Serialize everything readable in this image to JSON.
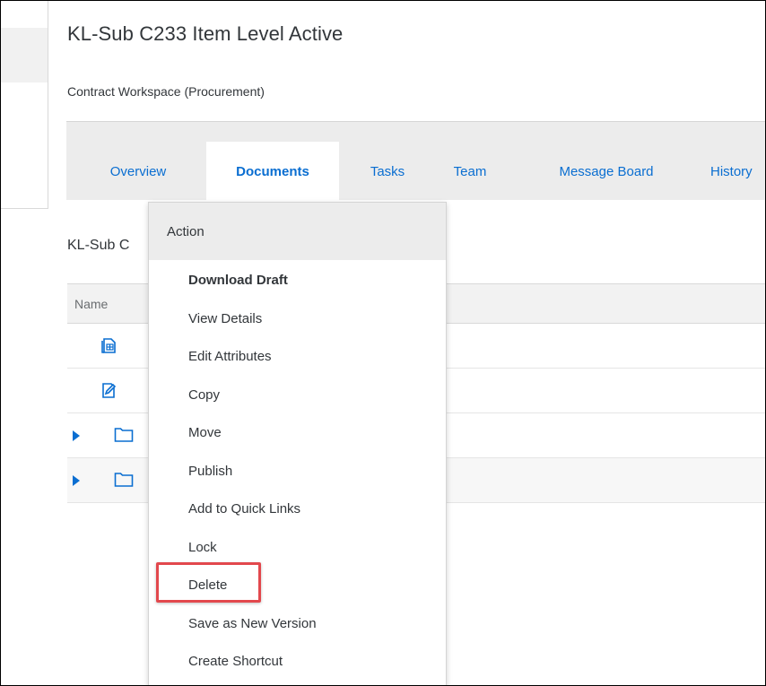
{
  "header": {
    "title": "KL-Sub C233 Item Level Active",
    "subtitle": "Contract Workspace (Procurement)"
  },
  "tabs": [
    {
      "label": "Overview",
      "active": false
    },
    {
      "label": "Documents",
      "active": true
    },
    {
      "label": "Tasks",
      "active": false
    },
    {
      "label": "Team",
      "active": false
    },
    {
      "label": "Message Board",
      "active": false
    },
    {
      "label": "History",
      "active": false
    }
  ],
  "content": {
    "crumb": "KL-Sub C",
    "table": {
      "columns": [
        "Name"
      ],
      "rows": [
        {
          "icon": "spreadsheet-document-icon",
          "expandable": false
        },
        {
          "icon": "edit-document-icon",
          "expandable": false
        },
        {
          "icon": "folder-icon",
          "expandable": true
        },
        {
          "icon": "folder-icon",
          "expandable": true
        }
      ]
    }
  },
  "menu": {
    "header": "Action",
    "items": [
      {
        "label": "Download Draft",
        "bold": true
      },
      {
        "label": "View Details"
      },
      {
        "label": "Edit Attributes"
      },
      {
        "label": "Copy"
      },
      {
        "label": "Move"
      },
      {
        "label": "Publish"
      },
      {
        "label": "Add to Quick Links"
      },
      {
        "label": "Lock"
      },
      {
        "label": "Delete",
        "highlighted": true
      },
      {
        "label": "Save as New Version"
      },
      {
        "label": "Create Shortcut"
      }
    ]
  },
  "colors": {
    "link": "#0a6ed1",
    "highlight": "#e2484d",
    "tabbar_bg": "#ececec"
  }
}
